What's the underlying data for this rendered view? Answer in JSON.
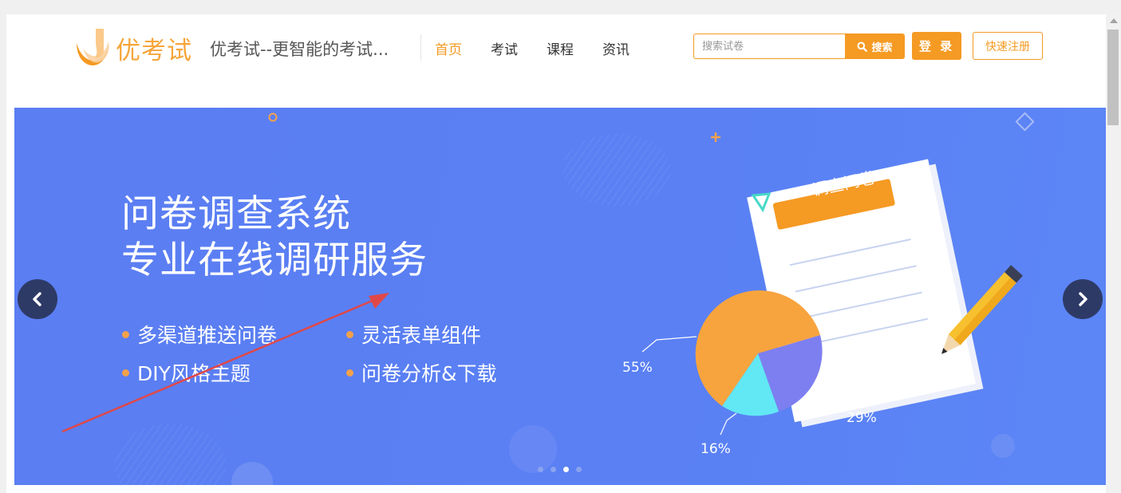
{
  "header": {
    "brand": "优考试",
    "site_title": "优考试--更智能的考试...",
    "nav": [
      "首页",
      "考试",
      "课程",
      "资讯"
    ],
    "search_placeholder": "搜索试卷",
    "search_label": "搜索",
    "login_label": "登 录",
    "register_label": "快速注册"
  },
  "banner": {
    "headline_line1": "问卷调查系统",
    "headline_line2": "专业在线调研服务",
    "features": [
      "多渠道推送问卷",
      "灵活表单组件",
      "DIY风格主题",
      "问卷分析&下载"
    ],
    "survey_tag": "调查问卷",
    "pie_labels": [
      "55%",
      "29%",
      "16%"
    ],
    "carousel_active_index": 2
  },
  "icons": {
    "logo": "brand-logo-icon",
    "search": "search-icon",
    "prev": "chevron-left-icon",
    "next": "chevron-right-icon"
  },
  "colors": {
    "accent": "#f59a23",
    "banner": "#5b7ef2",
    "arrow_button": "#2e3a66"
  }
}
